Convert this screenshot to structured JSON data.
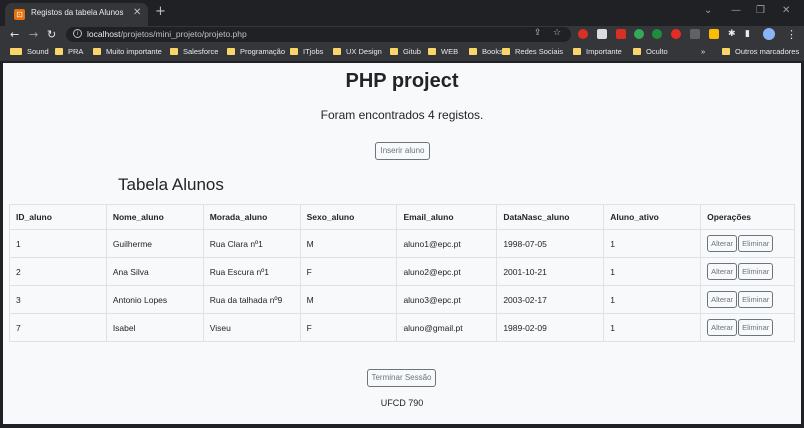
{
  "browser": {
    "tab_title": "Registos da tabela Alunos",
    "url_host": "localhost",
    "url_path": "/projetos/mini_projeto/projeto.php",
    "bookmarks": [
      "Sound",
      "PRA",
      "Muito importante",
      "Salesforce",
      "Programação",
      "ITjobs",
      "UX Design",
      "Gitub",
      "WEB",
      "Books",
      "Redes Sociais",
      "Importante",
      "Oculto"
    ],
    "other_bookmarks": "Outros marcadores",
    "extension_colors": [
      "#d93025",
      "#dadce0",
      "#d93025",
      "#34a853",
      "#1e8e3e",
      "#e52d27",
      "#5f6368",
      "#fbbc04"
    ]
  },
  "page": {
    "title": "PHP project",
    "found_text": "Foram encontrados 4 registos.",
    "insert_button": "Inserir aluno",
    "section_title": "Tabela Alunos",
    "table": {
      "headers": [
        "ID_aluno",
        "Nome_aluno",
        "Morada_aluno",
        "Sexo_aluno",
        "Email_aluno",
        "DataNasc_aluno",
        "Aluno_ativo",
        "Operações"
      ],
      "rows": [
        [
          "1",
          "Guilherme",
          "Rua Clara nº1",
          "M",
          "aluno1@epc.pt",
          "1998-07-05",
          "1"
        ],
        [
          "2",
          "Ana Silva",
          "Rua Escura nº1",
          "F",
          "aluno2@epc.pt",
          "2001-10-21",
          "1"
        ],
        [
          "3",
          "Antonio Lopes",
          "Rua da talhada nº9",
          "M",
          "aluno3@epc.pt",
          "2003-02-17",
          "1"
        ],
        [
          "7",
          "Isabel",
          "Viseu",
          "F",
          "aluno@gmail.pt",
          "1989-02-09",
          "1"
        ]
      ],
      "edit_label": "Alterar",
      "delete_label": "Eliminar"
    },
    "logout_button": "Terminar Sessão",
    "footer": "UFCD 790"
  }
}
